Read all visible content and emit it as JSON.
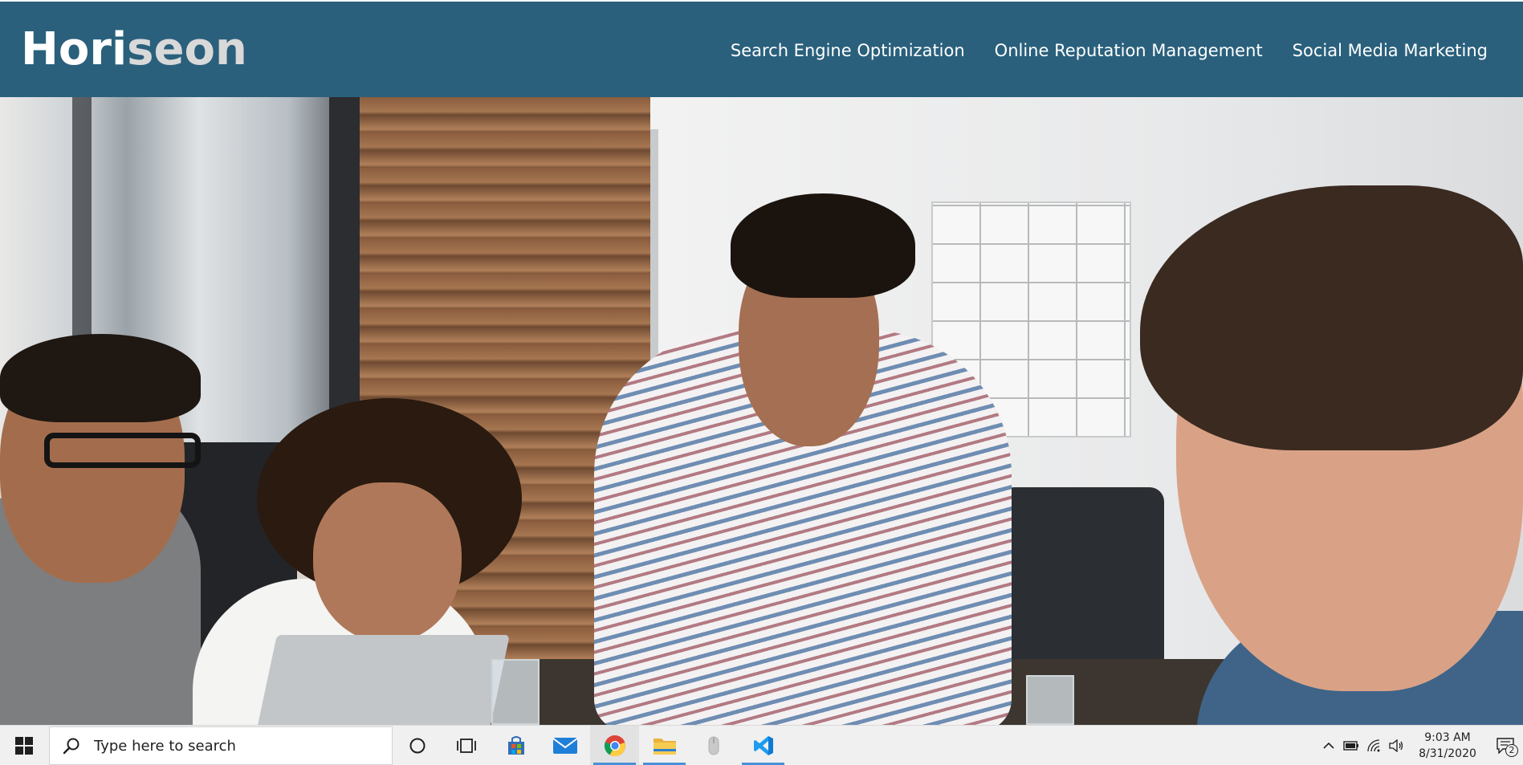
{
  "header": {
    "logo": {
      "part1": "Hori",
      "part2": "seo",
      "part3": "n"
    },
    "nav": [
      {
        "label": "Search Engine Optimization"
      },
      {
        "label": "Online Reputation Management"
      },
      {
        "label": "Social Media Marketing"
      }
    ],
    "background_color": "#2a607c"
  },
  "hero": {
    "image": "photo of four people collaborating around a table"
  },
  "taskbar": {
    "search": {
      "placeholder": "Type here to search"
    },
    "apps": [
      {
        "icon": "cortana-icon"
      },
      {
        "icon": "task-view-icon"
      },
      {
        "icon": "microsoft-store-icon"
      },
      {
        "icon": "mail-icon"
      },
      {
        "icon": "chrome-icon",
        "active": true
      },
      {
        "icon": "file-explorer-icon",
        "running": true
      },
      {
        "icon": "mouse-app-icon"
      },
      {
        "icon": "vscode-icon",
        "running": true
      }
    ],
    "clock": {
      "time": "9:03 AM",
      "date": "8/31/2020"
    },
    "notifications": {
      "count": "2"
    }
  }
}
